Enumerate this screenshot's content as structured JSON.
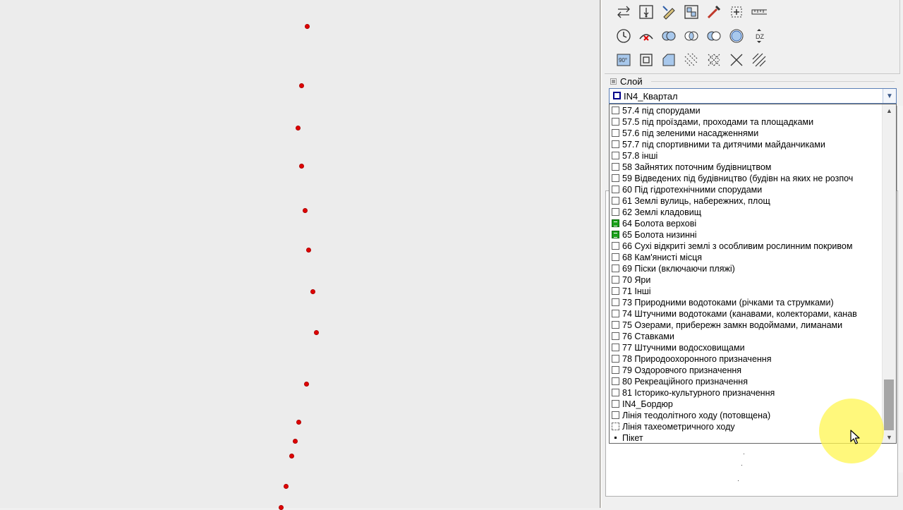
{
  "map": {
    "point_color": "#e00000",
    "points_label": "survey points"
  },
  "toolbox": {
    "rows": [
      [
        "swap-arrows-icon",
        "insert-vertex-icon",
        "pencil-edit-icon",
        "object-properties-icon",
        "pick-tool-icon",
        "zoom-frame-icon",
        "ruler-icon"
      ],
      [
        "clock-icon",
        "delete-arc-icon",
        "union-icon",
        "intersection-icon",
        "difference-icon",
        "circle-icon",
        "dz-height-icon"
      ],
      [
        "angle-90-icon",
        "square-frame-icon",
        "cut-corner-icon",
        "hatch-icon",
        "crosshatch-icon",
        "cross-lines-icon",
        "diagonal-hatch-icon"
      ]
    ],
    "dz_label": "DZ",
    "angle_label": "90°"
  },
  "layer_group": {
    "label": "Слой"
  },
  "layer_combo": {
    "value": "IN4_Квартал",
    "swatch_color": "#00008b"
  },
  "layer_list": {
    "items": [
      {
        "label": "57.4 під спорудами",
        "swatch": "empty"
      },
      {
        "label": "57.5 під проїздами, проходами та площадками",
        "swatch": "empty"
      },
      {
        "label": "57.6 під зеленими насадженнями",
        "swatch": "empty"
      },
      {
        "label": "57.7 під спортивними та дитячими майданчиками",
        "swatch": "empty"
      },
      {
        "label": "57.8 інші",
        "swatch": "empty"
      },
      {
        "label": "58 Зайнятих поточним будівництвом",
        "swatch": "empty"
      },
      {
        "label": "59 Відведених під будівництво (будівн  на яких не розпоч",
        "swatch": "empty"
      },
      {
        "label": "60 Під гідротехнічними спорудами",
        "swatch": "empty"
      },
      {
        "label": "61 Землі вулиць, набережних, площ",
        "swatch": "empty"
      },
      {
        "label": "62 Землі кладовищ",
        "swatch": "empty"
      },
      {
        "label": "64 Болота верхові",
        "swatch": "green"
      },
      {
        "label": "65 Болота низинні",
        "swatch": "green"
      },
      {
        "label": "66 Сухі відкриті землі з особливим рослинним покривом",
        "swatch": "empty"
      },
      {
        "label": "68 Кам'янисті місця",
        "swatch": "empty"
      },
      {
        "label": "69 Піски (включаючи пляжі)",
        "swatch": "empty"
      },
      {
        "label": "70 Яри",
        "swatch": "empty"
      },
      {
        "label": "71 Інші",
        "swatch": "empty"
      },
      {
        "label": "73 Природними водотоками (річками та струмками)",
        "swatch": "empty"
      },
      {
        "label": "74 Штучними водотоками (канавами, колекторами, канав",
        "swatch": "empty"
      },
      {
        "label": "75 Озерами, прибережн  замкн  водоймами, лиманами",
        "swatch": "empty"
      },
      {
        "label": "76 Ставками",
        "swatch": "empty"
      },
      {
        "label": "77 Штучними водосховищами",
        "swatch": "empty"
      },
      {
        "label": "78 Природоохоронного призначення",
        "swatch": "empty"
      },
      {
        "label": "79 Оздоровчого призначення",
        "swatch": "empty"
      },
      {
        "label": "80 Рекреаційного призначення",
        "swatch": "empty"
      },
      {
        "label": "81 Історико-культурного призначення",
        "swatch": "empty"
      },
      {
        "label": "IN4_Бордюр",
        "swatch": "empty"
      },
      {
        "label": "Лінія теодолітного ходу (потовщена)",
        "swatch": "empty"
      },
      {
        "label": "Лінія тахеометричного ходу",
        "swatch": "dashed"
      },
      {
        "label": "Пікет",
        "swatch": "dot"
      }
    ],
    "scroll_position_fraction": 0.88
  },
  "colors": {
    "accent": "#5a7fb6",
    "highlight": "#fff550",
    "point": "#e00000"
  }
}
